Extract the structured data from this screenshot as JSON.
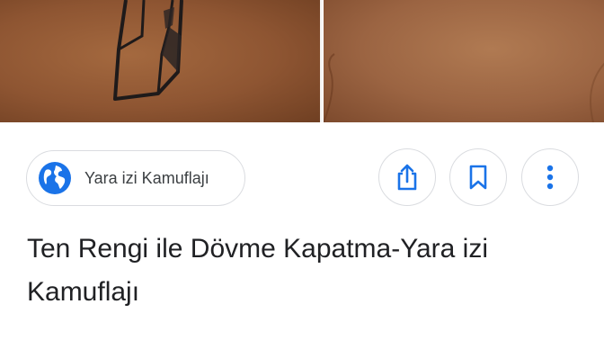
{
  "result": {
    "source": {
      "label": "Yara izi Kamuflajı",
      "icon": "globe-icon"
    },
    "actions": [
      {
        "name": "share",
        "icon": "share-icon"
      },
      {
        "name": "save",
        "icon": "bookmark-icon"
      },
      {
        "name": "more",
        "icon": "more-vert-icon"
      }
    ],
    "title": "Ten Rengi ile Dövme Kapatma-Yara izi Kamuflajı"
  },
  "colors": {
    "accent": "#1a73e8",
    "border": "#dadce0",
    "text": "#202124"
  }
}
